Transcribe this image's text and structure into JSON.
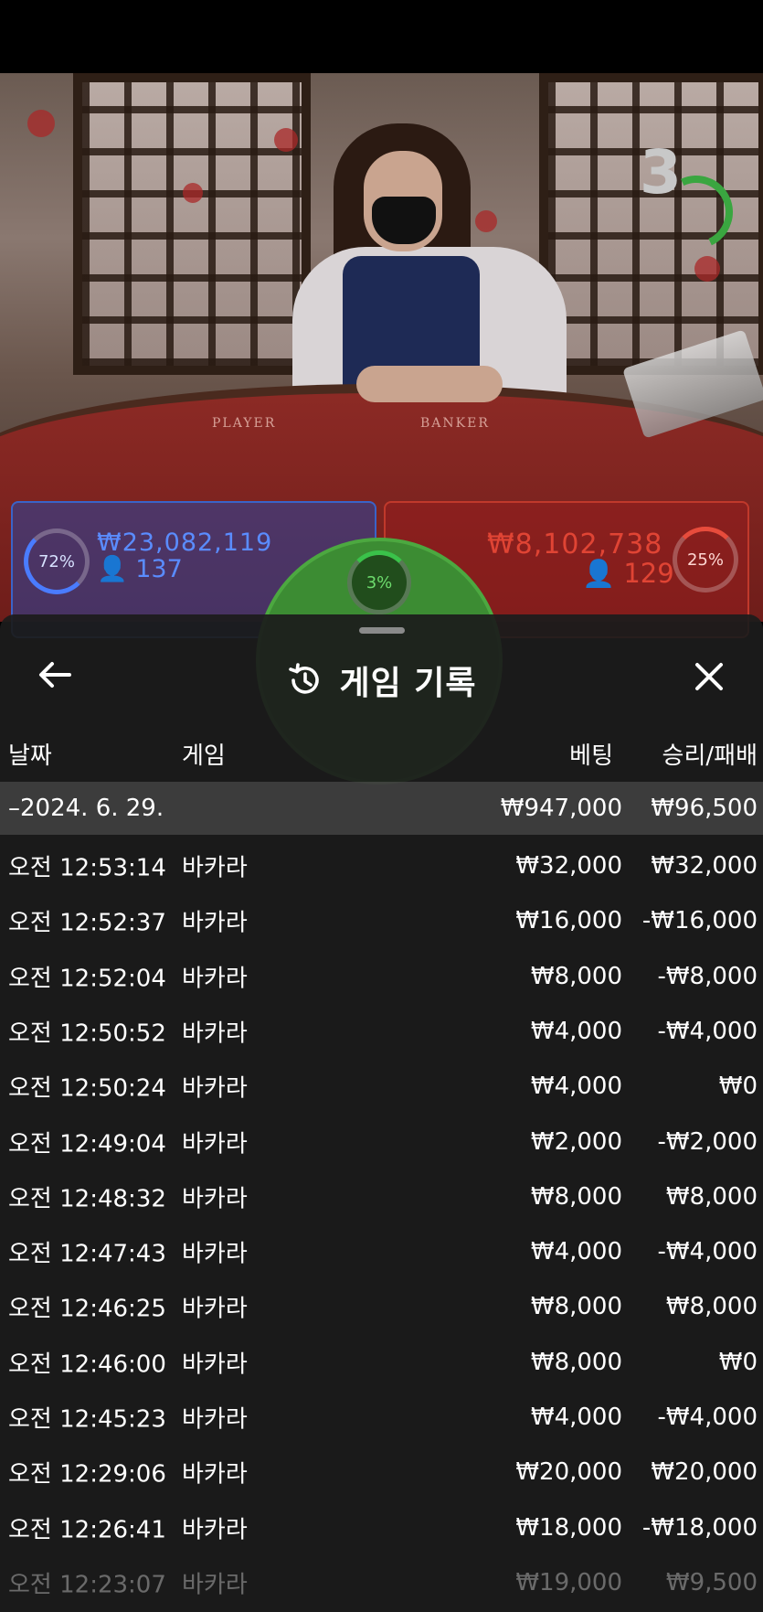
{
  "countdown": "3",
  "table_labels": {
    "player": "PLAYER",
    "banker": "BANKER"
  },
  "bets": {
    "player": {
      "percent": "72%",
      "amount": "₩23,082,119",
      "count": "137"
    },
    "banker": {
      "percent": "25%",
      "amount": "₩8,102,738",
      "count": "129"
    },
    "tie": {
      "percent": "3%"
    }
  },
  "sheet": {
    "title": "게임 기록",
    "icons": {
      "back": "arrow-left-icon",
      "history": "history-icon",
      "close": "close-icon"
    },
    "columns": {
      "date": "날짜",
      "game": "게임",
      "bet": "베팅",
      "win_loss": "승리/패배"
    },
    "summary": {
      "date": "–2024. 6. 29.",
      "bet": "₩947,000",
      "win_loss": "₩96,500"
    },
    "rows": [
      {
        "time": "오전 12:53:14",
        "game": "바카라",
        "bet": "₩32,000",
        "result": "₩32,000"
      },
      {
        "time": "오전 12:52:37",
        "game": "바카라",
        "bet": "₩16,000",
        "result": "-₩16,000"
      },
      {
        "time": "오전 12:52:04",
        "game": "바카라",
        "bet": "₩8,000",
        "result": "-₩8,000"
      },
      {
        "time": "오전 12:50:52",
        "game": "바카라",
        "bet": "₩4,000",
        "result": "-₩4,000"
      },
      {
        "time": "오전 12:50:24",
        "game": "바카라",
        "bet": "₩4,000",
        "result": "₩0"
      },
      {
        "time": "오전 12:49:04",
        "game": "바카라",
        "bet": "₩2,000",
        "result": "-₩2,000"
      },
      {
        "time": "오전 12:48:32",
        "game": "바카라",
        "bet": "₩8,000",
        "result": "₩8,000"
      },
      {
        "time": "오전 12:47:43",
        "game": "바카라",
        "bet": "₩4,000",
        "result": "-₩4,000"
      },
      {
        "time": "오전 12:46:25",
        "game": "바카라",
        "bet": "₩8,000",
        "result": "₩8,000"
      },
      {
        "time": "오전 12:46:00",
        "game": "바카라",
        "bet": "₩8,000",
        "result": "₩0"
      },
      {
        "time": "오전 12:45:23",
        "game": "바카라",
        "bet": "₩4,000",
        "result": "-₩4,000"
      },
      {
        "time": "오전 12:29:06",
        "game": "바카라",
        "bet": "₩20,000",
        "result": "₩20,000"
      },
      {
        "time": "오전 12:26:41",
        "game": "바카라",
        "bet": "₩18,000",
        "result": "-₩18,000"
      },
      {
        "time": "오전 12:23:07",
        "game": "바카라",
        "bet": "₩19,000",
        "result": "₩9,500"
      }
    ]
  }
}
